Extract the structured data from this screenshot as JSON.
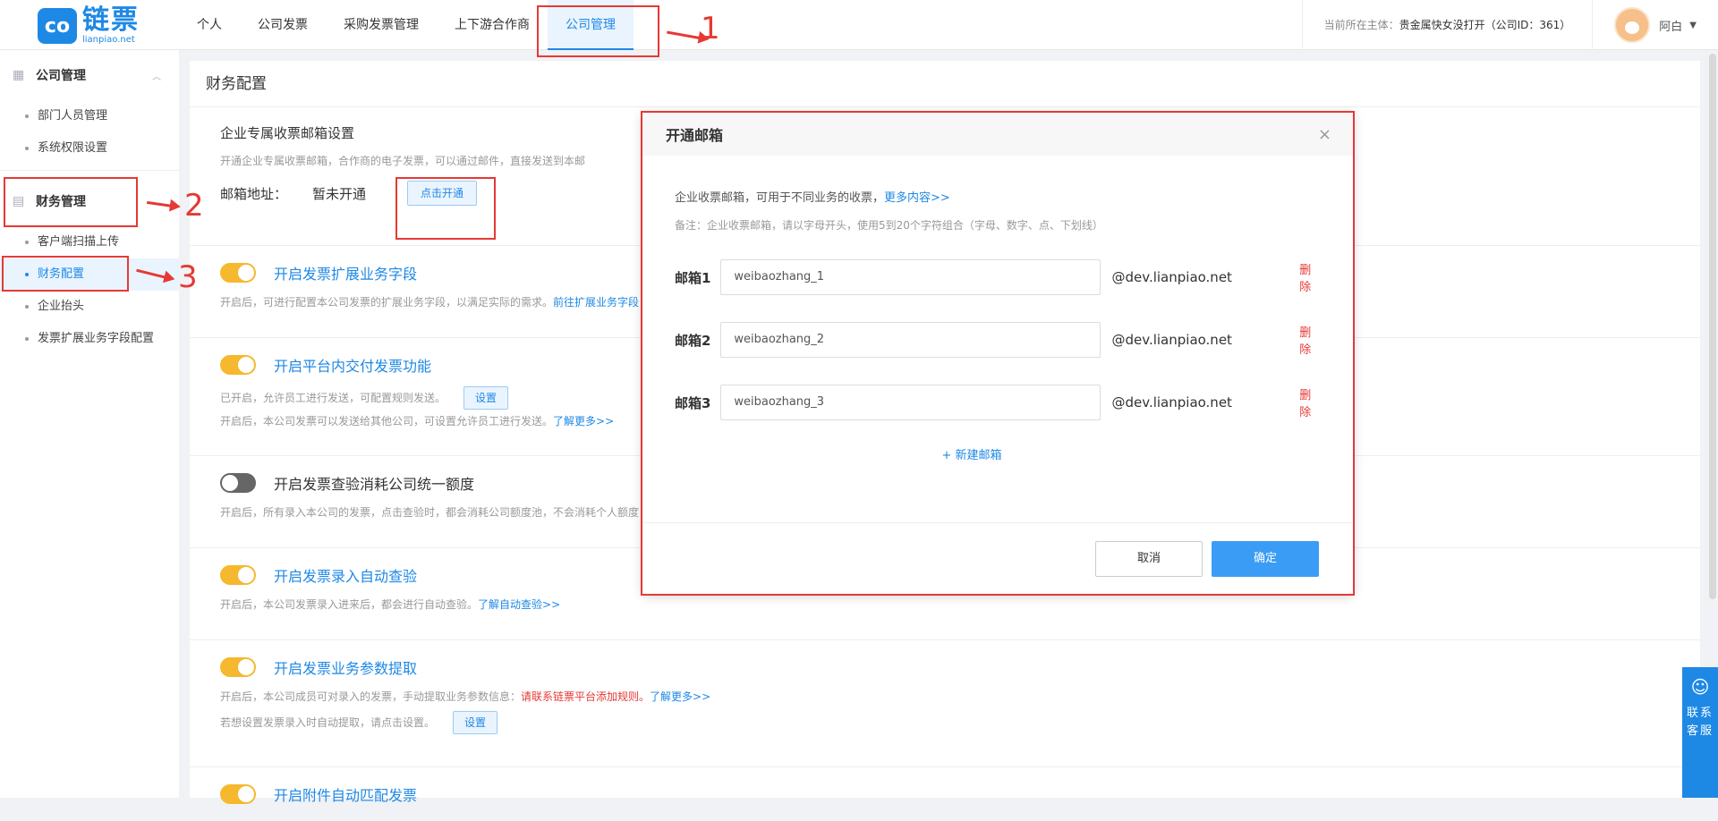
{
  "logo": {
    "mark": "co",
    "cn": "链票",
    "en": "lianpiao.net"
  },
  "nav": [
    "个人",
    "公司发票",
    "采购发票管理",
    "上下游合作商",
    "公司管理"
  ],
  "header": {
    "subject_label": "当前所在主体：",
    "subject_value": "贵金属快女没打开（公司ID：361）",
    "user_name": "阿白",
    "caret": "▼"
  },
  "sidebar": {
    "group1": "公司管理",
    "group1_items": [
      "部门人员管理",
      "系统权限设置"
    ],
    "group2": "财务管理",
    "group2_items": [
      "客户端扫描上传",
      "财务配置",
      "企业抬头",
      "发票扩展业务字段配置"
    ]
  },
  "main": {
    "title": "财务配置",
    "mail_section": {
      "title": "企业专属收票邮箱设置",
      "desc": "开通企业专属收票邮箱，合作商的电子发票，可以通过邮件，直接发送到本邮",
      "addr_label": "邮箱地址：",
      "addr_value": "暂未开通",
      "open_btn": "点击开通"
    },
    "ext_field": {
      "label": "开启发票扩展业务字段",
      "desc": "开启后，可进行配置本公司发票的扩展业务字段，以满足实际的需求。",
      "link": "前往扩展业务字段"
    },
    "deliver": {
      "label": "开启平台内交付发票功能",
      "desc1": "已开启，允许员工进行发送，可配置规则发送。",
      "set_btn": "设置",
      "desc2": "开启后，本公司发票可以发送给其他公司，可设置允许员工进行发送。",
      "link": "了解更多>>"
    },
    "quota": {
      "label": "开启发票查验消耗公司统一额度",
      "desc": "开启后，所有录入本公司的发票，点击查验时，都会消耗公司额度池，不会消耗个人额度"
    },
    "auto_check": {
      "label": "开启发票录入自动查验",
      "desc": "开启后，本公司发票录入进来后，都会进行自动查验。",
      "link": "了解自动查验>>"
    },
    "param": {
      "label": "开启发票业务参数提取",
      "desc": "开启后，本公司成员可对录入的发票，手动提取业务参数信息：",
      "red": "请联系链票平台添加规则。",
      "link": "了解更多>>",
      "desc2": "若想设置发票录入时自动提取，请点击设置。",
      "set_btn": "设置"
    },
    "attach": {
      "label": "开启附件自动匹配发票"
    }
  },
  "modal": {
    "title": "开通邮箱",
    "close": "×",
    "desc": "企业收票邮箱，可用于不同业务的收票，",
    "desc_link": "更多内容>>",
    "note": "备注：企业收票邮箱，请以字母开头，使用5到20个字符组合（字母、数字、点、下划线）",
    "mailboxes": [
      {
        "label": "邮箱1",
        "value": "weibaozhang_1",
        "domain": "@dev.lianpiao.net",
        "del": "删除"
      },
      {
        "label": "邮箱2",
        "value": "weibaozhang_2",
        "domain": "@dev.lianpiao.net",
        "del": "删除"
      },
      {
        "label": "邮箱3",
        "value": "weibaozhang_3",
        "domain": "@dev.lianpiao.net",
        "del": "删除"
      }
    ],
    "add": "+ 新建邮箱",
    "cancel": "取消",
    "ok": "确定"
  },
  "annotations": [
    "1",
    "2",
    "3"
  ],
  "help": {
    "icon": "chat-icon",
    "text": "联系客服"
  },
  "colors": {
    "primary": "#1e88e5",
    "annotation": "#e53935",
    "toggle_on": "#f5b82e"
  }
}
